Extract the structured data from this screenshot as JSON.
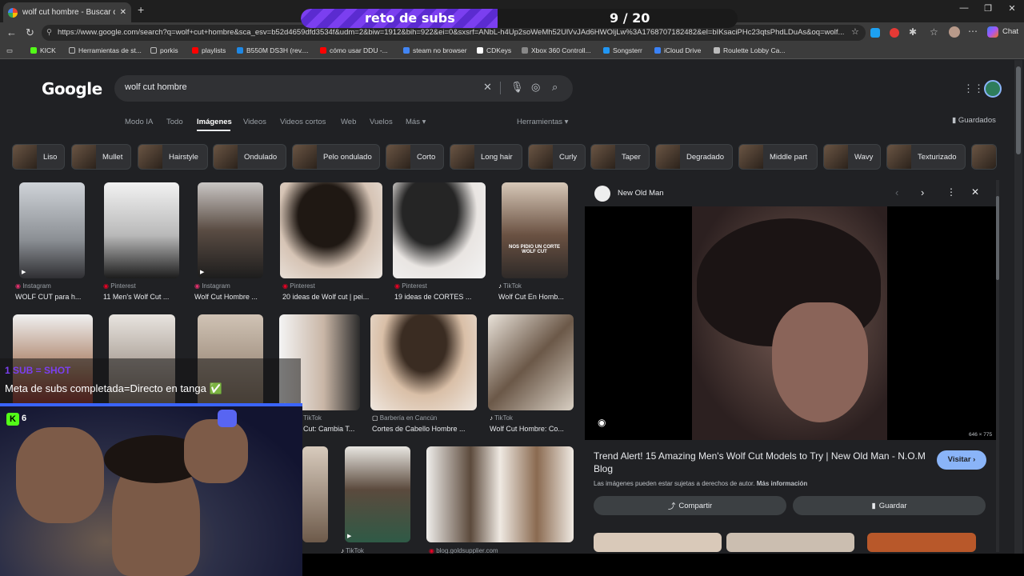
{
  "browser": {
    "tab_title": "wolf cut hombre - Buscar con Goo",
    "url": "https://www.google.com/search?q=wolf+cut+hombre&sca_esv=b52d4659dfd3534f&udm=2&biw=1912&bih=922&ei=0&sxsrf=ANbL-h4Up2soWeMh52UlVvJAd6HWOljLw%3A1768707182482&el=bIKsaciPHc23qtsPhdLDuAs&oq=wolf...",
    "chat_label": "Chat",
    "bookmarks": [
      "KICK",
      "Herramientas de st...",
      "porkis",
      "playlists",
      "B550M DS3H (rev....",
      "cómo usar DDU -...",
      "steam no browser",
      "CDKeys",
      "Xbox 360 Controll...",
      "Songsterr",
      "iCloud Drive",
      "Roulette Lobby Ca..."
    ]
  },
  "overlay": {
    "sub_challenge_label": "reto de subs",
    "sub_challenge_count": "9 / 20",
    "sub_progress": 0.45,
    "banner_line1": "1 SUB = SHOT",
    "banner_line2": "Meta de subs completada=Directo en tanga ✅",
    "kick_viewers": "6"
  },
  "google": {
    "logo": "Google",
    "query": "wolf cut hombre",
    "tabs": [
      "Modo IA",
      "Todo",
      "Imágenes",
      "Videos",
      "Videos cortos",
      "Web",
      "Vuelos",
      "Más ▾"
    ],
    "tools": "Herramientas ▾",
    "saved": "Guardados",
    "chips": [
      "Liso",
      "Mullet",
      "Hairstyle",
      "Ondulado",
      "Pelo ondulado",
      "Corto",
      "Long hair",
      "Curly",
      "Taper",
      "Degradado",
      "Middle part",
      "Wavy",
      "Texturizado"
    ],
    "results_row1": [
      {
        "source": "Instagram",
        "caption": "WOLF CUT para h..."
      },
      {
        "source": "Pinterest",
        "caption": "11 Men's Wolf Cut ..."
      },
      {
        "source": "Instagram",
        "caption": "Wolf Cut Hombre ..."
      },
      {
        "source": "Pinterest",
        "caption": "20 ideas de Wolf cut | pei..."
      },
      {
        "source": "Pinterest",
        "caption": "19 ideas de CORTES ..."
      },
      {
        "source": "TikTok",
        "caption": "Wolf Cut En Homb..."
      }
    ],
    "results_row2": [
      {
        "source": "TikTok",
        "caption": "Cut: Cambia T..."
      },
      {
        "source": "Barbería en Cancún",
        "caption": "Cortes de Cabello Hombre ..."
      },
      {
        "source": "TikTok",
        "caption": "Wolf Cut Hombre: Co..."
      }
    ],
    "results_row3": [
      {
        "source": "TikTok",
        "caption": ""
      },
      {
        "source": "blog.goldsupplier.com",
        "caption": ""
      }
    ],
    "tiktok_overlay_text": "NOS PIDIO UN CORTE WOLF CUT"
  },
  "panel": {
    "site": "New Old Man",
    "dimensions": "646 × 775",
    "title": "Trend Alert! 15 Amazing Men's Wolf Cut Models to Try | New Old Man - N.O.M Blog",
    "visit_label": "Visitar",
    "notice": "Las imágenes pueden estar sujetas a derechos de autor.",
    "notice_link": "Más información",
    "share_label": "Compartir",
    "save_label": "Guardar"
  },
  "colors": {
    "accent_purple": "#7b3ff0",
    "kick_green": "#53fc18",
    "google_blue": "#8ab4f8"
  }
}
